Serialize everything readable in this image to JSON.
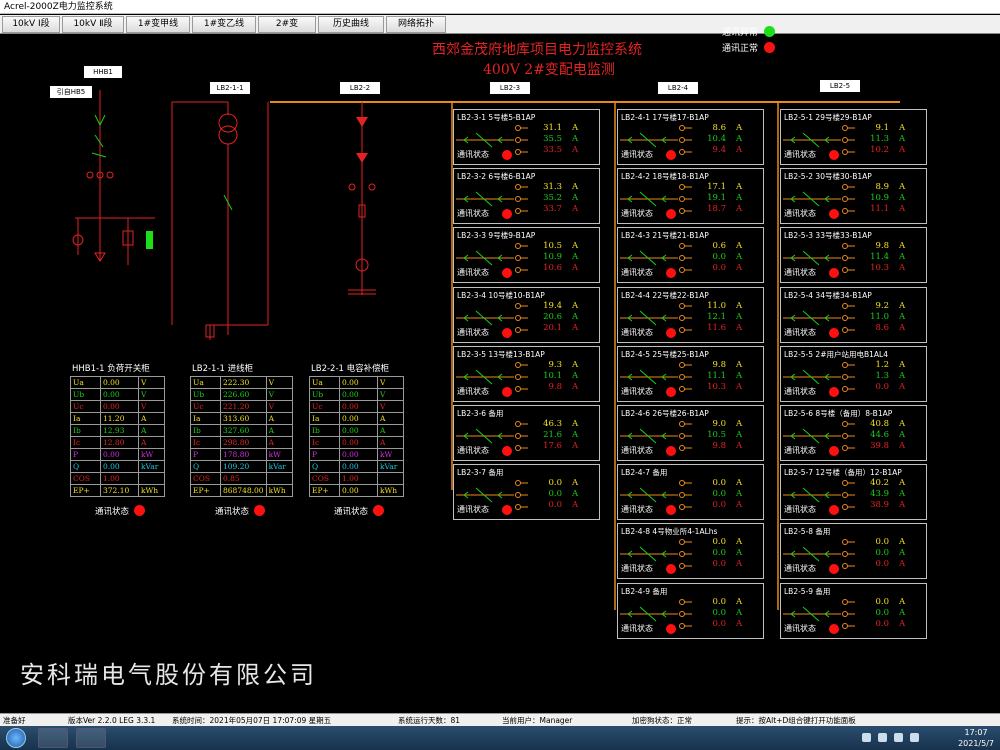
{
  "window": {
    "title": "Acrel-2000Z电力监控系统"
  },
  "menu": [
    "10kV Ⅰ段",
    "10kV Ⅱ段",
    "1#变甲线",
    "1#变乙线",
    "2#变",
    "历史曲线",
    "网络拓扑"
  ],
  "header": {
    "title1": "西郊金茂府地库项目电力监控系统",
    "title2": "400V  2#变配电监测",
    "legend_abnormal": "通讯异常",
    "legend_normal": "通讯正常",
    "abnormal_color": "#19e019",
    "normal_color": "#ff1010"
  },
  "diagram": {
    "hhb1": "HHB1",
    "yin": "引自HB5",
    "lb21": "LB2-1-1",
    "lb22": "LB2-2",
    "lb23": "LB2-3",
    "lb24": "LB2-4",
    "lb25": "LB2-5"
  },
  "feeders": [
    {
      "name": "LB2-3-1 5号楼5-B1AP",
      "a": "31.1",
      "b": "35.5",
      "c": "33.5"
    },
    {
      "name": "LB2-3-2 6号楼6-B1AP",
      "a": "31.3",
      "b": "35.2",
      "c": "33.7"
    },
    {
      "name": "LB2-3-3 9号楼9-B1AP",
      "a": "10.5",
      "b": "10.9",
      "c": "10.6"
    },
    {
      "name": "LB2-3-4 10号楼10-B1AP",
      "a": "19.4",
      "b": "20.6",
      "c": "20.1"
    },
    {
      "name": "LB2-3-5 13号楼13-B1AP",
      "a": "9.3",
      "b": "10.1",
      "c": "9.8"
    },
    {
      "name": "LB2-3-6 备用",
      "a": "46.3",
      "b": "21.6",
      "c": "17.6"
    },
    {
      "name": "LB2-3-7 备用",
      "a": "0.0",
      "b": "0.0",
      "c": "0.0"
    },
    {
      "name": "LB2-4-1 17号楼17-B1AP",
      "a": "8.6",
      "b": "10.4",
      "c": "9.4"
    },
    {
      "name": "LB2-4-2 18号楼18-B1AP",
      "a": "17.1",
      "b": "19.1",
      "c": "18.7"
    },
    {
      "name": "LB2-4-3 21号楼21-B1AP",
      "a": "0.6",
      "b": "0.0",
      "c": "0.0"
    },
    {
      "name": "LB2-4-4 22号楼22-B1AP",
      "a": "11.0",
      "b": "12.1",
      "c": "11.6"
    },
    {
      "name": "LB2-4-5 25号楼25-B1AP",
      "a": "9.8",
      "b": "11.1",
      "c": "10.3"
    },
    {
      "name": "LB2-4-6 26号楼26-B1AP",
      "a": "9.0",
      "b": "10.5",
      "c": "9.8"
    },
    {
      "name": "LB2-4-7 备用",
      "a": "0.0",
      "b": "0.0",
      "c": "0.0"
    },
    {
      "name": "LB2-4-8 4号物业所4-1ALhs",
      "a": "0.0",
      "b": "0.0",
      "c": "0.0"
    },
    {
      "name": "LB2-4-9 备用",
      "a": "0.0",
      "b": "0.0",
      "c": "0.0"
    },
    {
      "name": "LB2-5-1 29号楼29-B1AP",
      "a": "9.1",
      "b": "11.3",
      "c": "10.2"
    },
    {
      "name": "LB2-5-2 30号楼30-B1AP",
      "a": "8.9",
      "b": "10.9",
      "c": "11.1"
    },
    {
      "name": "LB2-5-3 33号楼33-B1AP",
      "a": "9.8",
      "b": "11.4",
      "c": "10.3"
    },
    {
      "name": "LB2-5-4 34号楼34-B1AP",
      "a": "9.2",
      "b": "11.0",
      "c": "8.6"
    },
    {
      "name": "LB2-5-5 2#用户站用电B1AL4",
      "a": "1.2",
      "b": "1.3",
      "c": "0.0"
    },
    {
      "name": "LB2-5-6 8号楼（备用）8-B1AP",
      "a": "40.8",
      "b": "44.6",
      "c": "39.8"
    },
    {
      "name": "LB2-5-7 12号楼（备用）12-B1AP",
      "a": "40.2",
      "b": "43.9",
      "c": "38.9"
    },
    {
      "name": "LB2-5-8 备用",
      "a": "0.0",
      "b": "0.0",
      "c": "0.0"
    },
    {
      "name": "LB2-5-9 备用",
      "a": "0.0",
      "b": "0.0",
      "c": "0.0"
    }
  ],
  "feeder_unit": "A",
  "comm_label": "通讯状态",
  "panels": [
    {
      "title": "HHB1-1 负荷开关柜",
      "rows": [
        {
          "k": "Ua",
          "v": "0.00",
          "u": "V"
        },
        {
          "k": "Ub",
          "v": "0.00",
          "u": "V"
        },
        {
          "k": "Uc",
          "v": "0.00",
          "u": "V"
        },
        {
          "k": "Ia",
          "v": "11.20",
          "u": "A"
        },
        {
          "k": "Ib",
          "v": "12.93",
          "u": "A"
        },
        {
          "k": "Ic",
          "v": "12.80",
          "u": "A"
        },
        {
          "k": "P",
          "v": "0.00",
          "u": "kW"
        },
        {
          "k": "Q",
          "v": "0.00",
          "u": "kVar"
        },
        {
          "k": "COS",
          "v": "1.00",
          "u": ""
        },
        {
          "k": "EP+",
          "v": "372.10",
          "u": "kWh"
        }
      ]
    },
    {
      "title": "LB2-1-1 进线柜",
      "rows": [
        {
          "k": "Ua",
          "v": "222.30",
          "u": "V"
        },
        {
          "k": "Ub",
          "v": "226.60",
          "u": "V"
        },
        {
          "k": "Uc",
          "v": "221.20",
          "u": "V"
        },
        {
          "k": "Ia",
          "v": "313.60",
          "u": "A"
        },
        {
          "k": "Ib",
          "v": "327.60",
          "u": "A"
        },
        {
          "k": "Ic",
          "v": "298.80",
          "u": "A"
        },
        {
          "k": "P",
          "v": "178.80",
          "u": "kW"
        },
        {
          "k": "Q",
          "v": "109.20",
          "u": "kVar"
        },
        {
          "k": "COS",
          "v": "0.85",
          "u": ""
        },
        {
          "k": "EP+",
          "v": "868748.00",
          "u": "kWh"
        }
      ]
    },
    {
      "title": "LB2-2-1 电容补偿柜",
      "rows": [
        {
          "k": "Ua",
          "v": "0.00",
          "u": "V"
        },
        {
          "k": "Ub",
          "v": "0.00",
          "u": "V"
        },
        {
          "k": "Uc",
          "v": "0.00",
          "u": "V"
        },
        {
          "k": "Ia",
          "v": "0.00",
          "u": "A"
        },
        {
          "k": "Ib",
          "v": "0.00",
          "u": "A"
        },
        {
          "k": "Ic",
          "v": "0.00",
          "u": "A"
        },
        {
          "k": "P",
          "v": "0.00",
          "u": "kW"
        },
        {
          "k": "Q",
          "v": "0.00",
          "u": "kVar"
        },
        {
          "k": "COS",
          "v": "1.00",
          "u": ""
        },
        {
          "k": "EP+",
          "v": "0.00",
          "u": "kWh"
        }
      ]
    }
  ],
  "company": "安科瑞电气股份有限公司",
  "statusbar": {
    "ready": "准备好",
    "version": "版本Ver 2.2.0 LEG 3.3.1",
    "time": "系统时间：2021年05月07日 17:07:09 星期五",
    "days": "系统运行天数：81",
    "user": "当前用户：Manager",
    "dog": "加密狗状态：正常",
    "hint": "提示：按Alt+D组合键打开功能面板"
  },
  "taskbar": {
    "time": "17:07",
    "date": "2021/5/7"
  }
}
